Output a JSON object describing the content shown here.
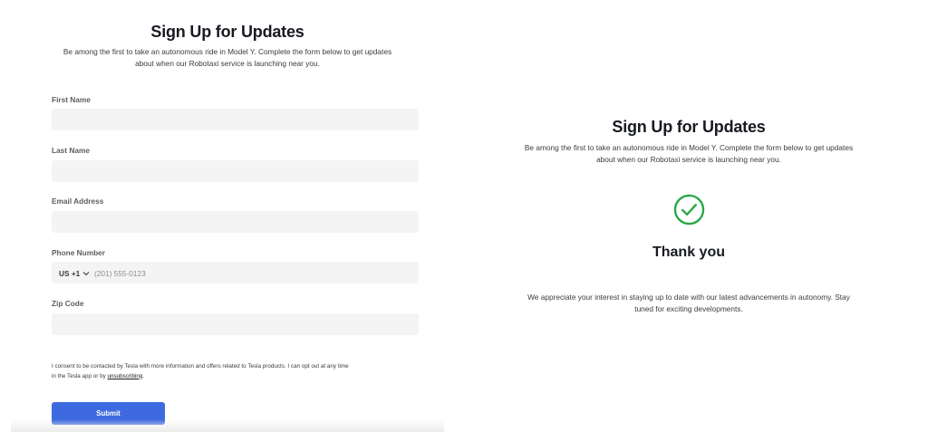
{
  "signup_form": {
    "title": "Sign Up for Updates",
    "subtitle_line1": "Be among the first to take an autonomous ride in Model Y. Complete the form below to get updates",
    "subtitle_line2": "about when our Robotaxi service is launching near you.",
    "fields": {
      "first_name": {
        "label": "First Name",
        "value": ""
      },
      "last_name": {
        "label": "Last Name",
        "value": ""
      },
      "email": {
        "label": "Email Address",
        "value": ""
      },
      "phone": {
        "label": "Phone Number",
        "country_code": "US +1",
        "placeholder": "(201) 555-0123"
      },
      "zip": {
        "label": "Zip Code",
        "value": ""
      }
    },
    "consent": {
      "text_line1": "I consent to be contacted by Tesla with more information and offers related to Tesla products. I can opt out at any time",
      "text_line2_prefix": "in the Tesla app or by ",
      "link": "unsubscribing",
      "text_line2_suffix": "."
    },
    "submit_label": "Submit",
    "accent_color": "#3e6ae1"
  },
  "confirmation": {
    "title": "Sign Up for Updates",
    "subtitle_line1": "Be among the first to take an autonomous ride in Model Y. Complete the form below to get updates",
    "subtitle_line2": "about when our Robotaxi service is launching near you.",
    "icon": "check-circle-icon",
    "success_color": "#28a745",
    "thanks": "Thank you",
    "message_line1": "We appreciate your interest in staying up to date with our latest advancements in autonomy. Stay",
    "message_line2": "tuned for exciting developments."
  }
}
